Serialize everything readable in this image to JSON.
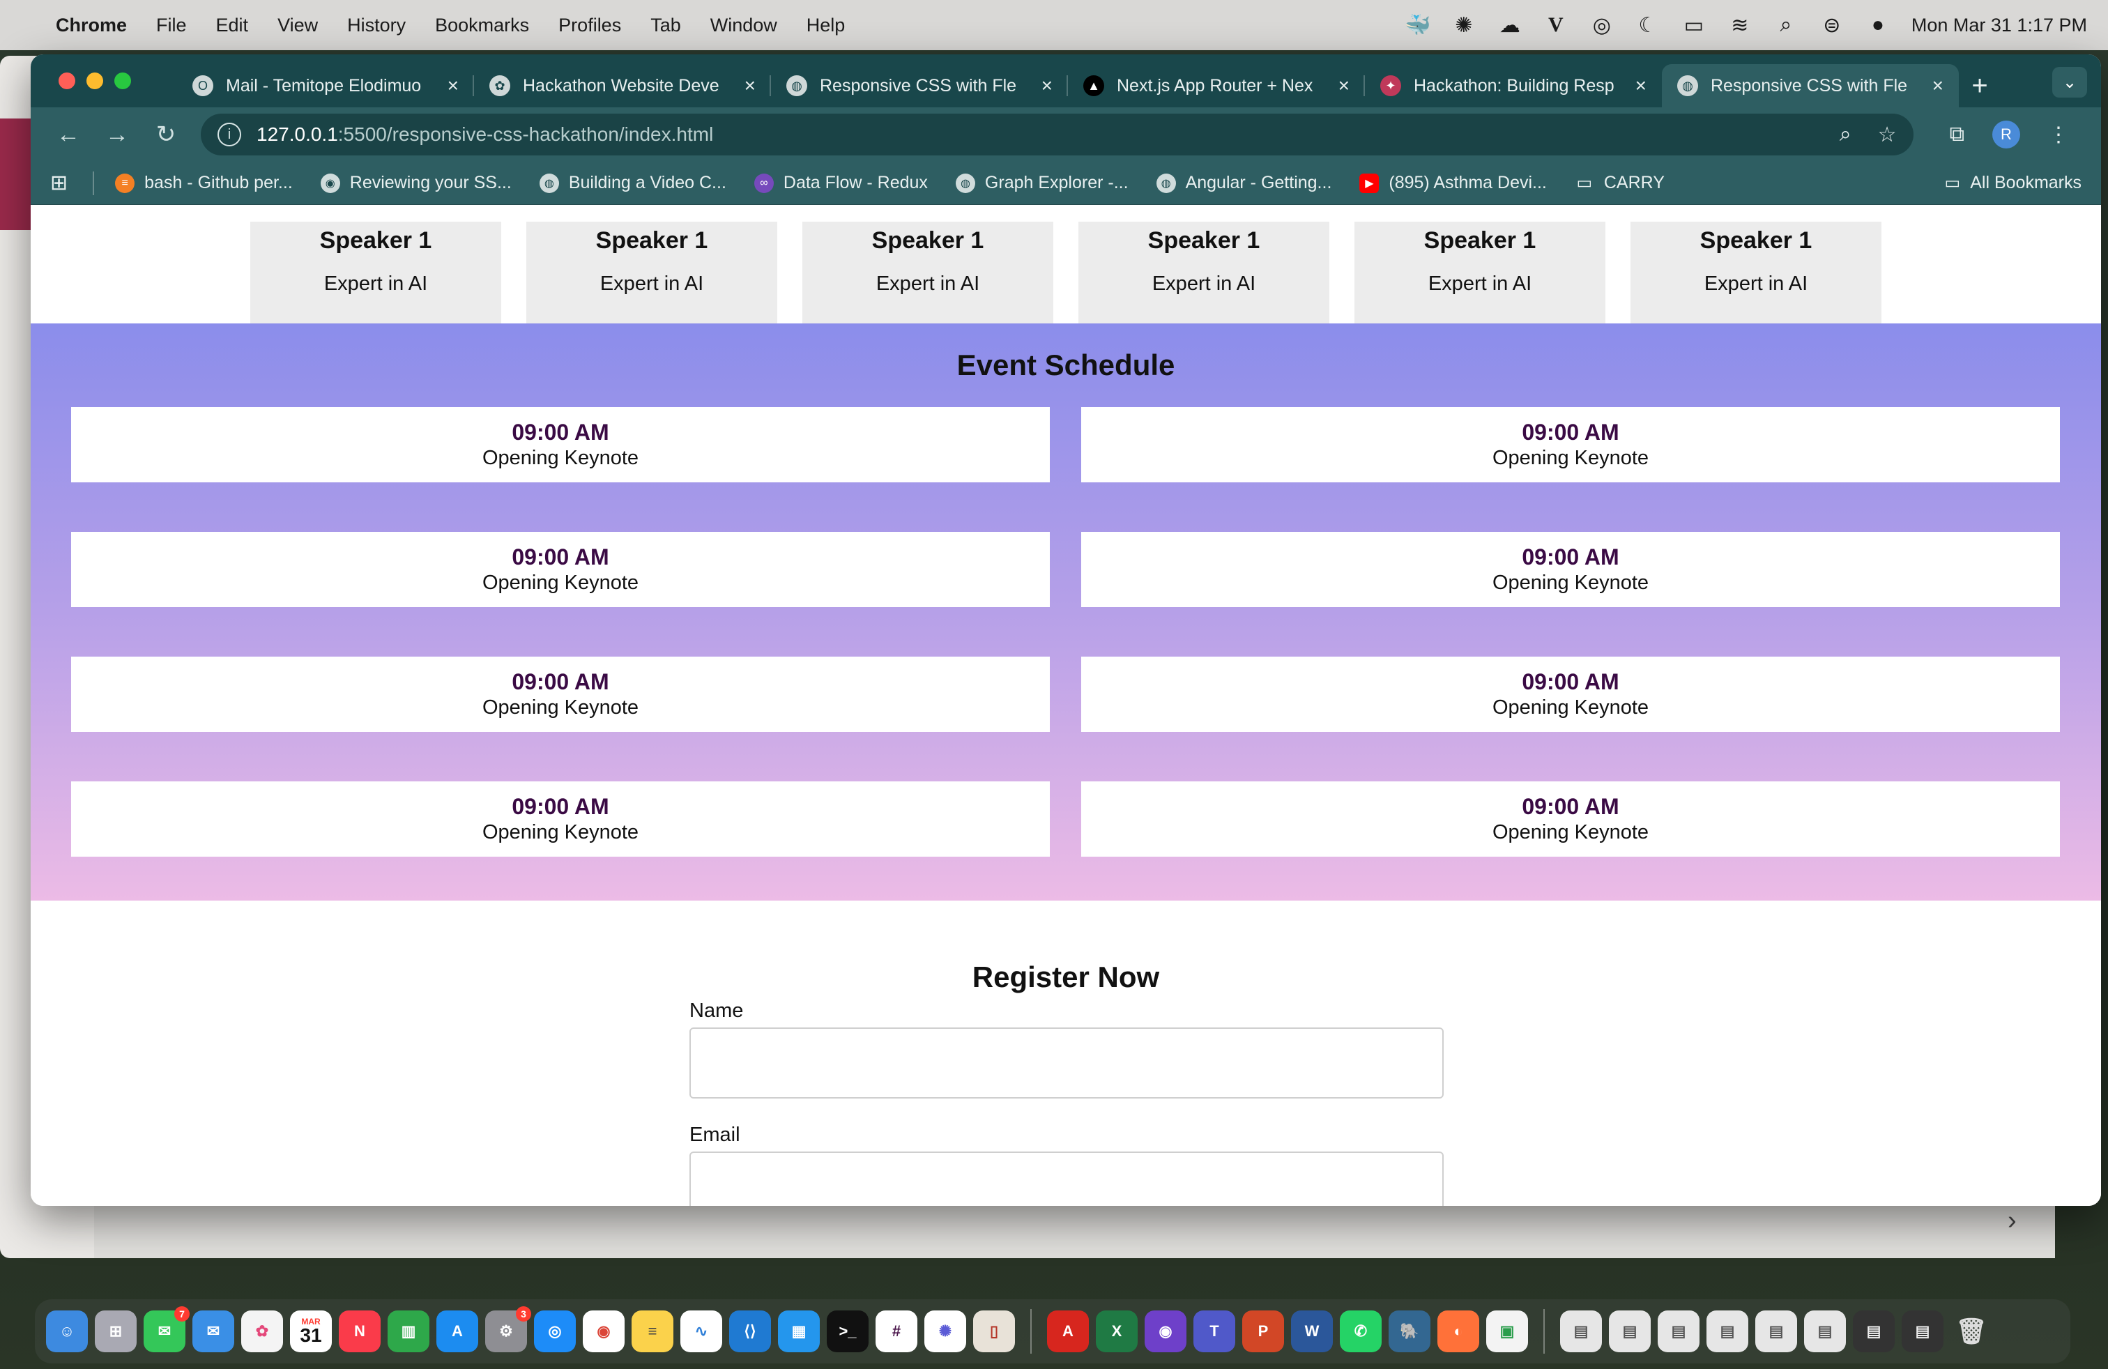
{
  "menubar": {
    "app": "Chrome",
    "items": [
      "File",
      "Edit",
      "View",
      "History",
      "Bookmarks",
      "Profiles",
      "Tab",
      "Window",
      "Help"
    ],
    "clock": "Mon Mar 31  1:17 PM"
  },
  "tabs": [
    {
      "title": "Mail - Temitope Elodimuo",
      "icon": "outlook-icon"
    },
    {
      "title": "Hackathon Website Deve",
      "icon": "openai-icon"
    },
    {
      "title": "Responsive CSS with Fle",
      "icon": "globe-icon"
    },
    {
      "title": "Next.js App Router + Nex",
      "icon": "nextjs-icon"
    },
    {
      "title": "Hackathon: Building Resp",
      "icon": "app-icon"
    },
    {
      "title": "Responsive CSS with Fle",
      "icon": "globe-icon",
      "active": true
    }
  ],
  "omnibox": {
    "host": "127.0.0.1",
    "path": ":5500/responsive-css-hackathon/index.html"
  },
  "profile_initial": "R",
  "bookmarks": [
    {
      "label": "bash - Github per...",
      "icon": "stackoverflow-icon"
    },
    {
      "label": "Reviewing your SS...",
      "icon": "github-icon"
    },
    {
      "label": "Building a Video C...",
      "icon": "globe-icon"
    },
    {
      "label": "Data Flow - Redux",
      "icon": "redux-icon"
    },
    {
      "label": "Graph Explorer -...",
      "icon": "globe-icon"
    },
    {
      "label": "Angular - Getting...",
      "icon": "globe-icon"
    },
    {
      "label": "(895) Asthma Devi...",
      "icon": "youtube-icon"
    },
    {
      "label": "CARRY",
      "icon": "folder-icon"
    }
  ],
  "all_bookmarks": "All Bookmarks",
  "page": {
    "speakers": [
      {
        "name": "Speaker 1",
        "role": "Expert in AI"
      },
      {
        "name": "Speaker 1",
        "role": "Expert in AI"
      },
      {
        "name": "Speaker 1",
        "role": "Expert in AI"
      },
      {
        "name": "Speaker 1",
        "role": "Expert in AI"
      },
      {
        "name": "Speaker 1",
        "role": "Expert in AI"
      },
      {
        "name": "Speaker 1",
        "role": "Expert in AI"
      }
    ],
    "schedule_title": "Event Schedule",
    "schedule": [
      {
        "time": "09:00 AM",
        "title": "Opening Keynote"
      },
      {
        "time": "09:00 AM",
        "title": "Opening Keynote"
      },
      {
        "time": "09:00 AM",
        "title": "Opening Keynote"
      },
      {
        "time": "09:00 AM",
        "title": "Opening Keynote"
      },
      {
        "time": "09:00 AM",
        "title": "Opening Keynote"
      },
      {
        "time": "09:00 AM",
        "title": "Opening Keynote"
      },
      {
        "time": "09:00 AM",
        "title": "Opening Keynote"
      },
      {
        "time": "09:00 AM",
        "title": "Opening Keynote"
      }
    ],
    "register_title": "Register Now",
    "fields": [
      {
        "label": "Name",
        "value": ""
      },
      {
        "label": "Email",
        "value": ""
      }
    ]
  },
  "dock_badges": {
    "messages": "7",
    "settings": "3",
    "calendar_month": "MAR",
    "calendar_day": "31"
  },
  "colors": {
    "tabbar": "#19474b",
    "toolbar": "#2e5e62",
    "schedule_top": "#8b8deb",
    "schedule_bottom": "#ecbbe6",
    "time_text": "#3a0a44"
  }
}
